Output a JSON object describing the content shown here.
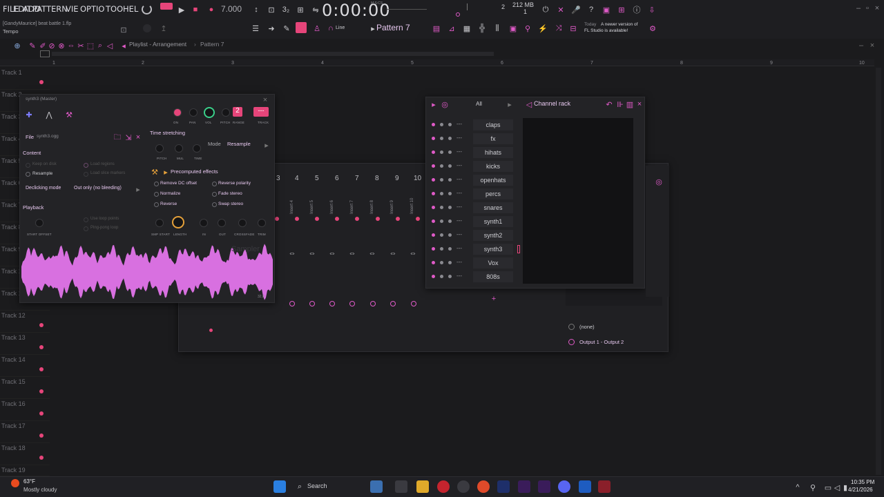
{
  "menu": [
    "FILE",
    "EDIT",
    "ADD",
    "PATTERN",
    "VIE",
    "OPTIO",
    "TOO",
    "HEL"
  ],
  "transport": {
    "tempo": "7.000",
    "clock": "0:00:00",
    "time_mode": "M:S:CS"
  },
  "perf": {
    "memory": "212 MB",
    "polyphony": "2",
    "cpu": "1"
  },
  "hint": {
    "project": "[GandyMaurice] beat battle 1.flp",
    "label": "Tempo"
  },
  "toolbar": {
    "snap": "Line",
    "pattern": "Pattern 7"
  },
  "news": {
    "day": "Today",
    "line1": "A newer version of",
    "line2": "FL Studio is available!"
  },
  "playlist": {
    "title": "Playlist - Arrangement",
    "pattern": "Pattern 7",
    "ruler": [
      "1",
      "2",
      "3",
      "4",
      "5",
      "6",
      "7",
      "8",
      "9",
      "10"
    ],
    "tracks": [
      "Track 1",
      "Track 2",
      "Track 3",
      "Track 4",
      "Track 5",
      "Track 6",
      "Track 7",
      "Track 8",
      "Track 9",
      "Track 10",
      "Track 11",
      "Track 12",
      "Track 13",
      "Track 14",
      "Track 15",
      "Track 16",
      "Track 17",
      "Track 18",
      "Track 19"
    ]
  },
  "sampler": {
    "title": "synth3 (Master)",
    "file_label": "File",
    "file_value": "synth3.ogg",
    "content": "Content",
    "keep_on_disk": "Keep on disk",
    "load_regions": "Load regions",
    "resample": "Resample",
    "load_slice": "Load slice markers",
    "declicking": "Declicking mode",
    "declick_value": "Out only (no bleeding)",
    "playback": "Playback",
    "use_loop": "Use loop points",
    "pingpong": "Ping-pong loop",
    "time_stretching": "Time stretching",
    "mode_label": "Mode",
    "mode_value": "Resample",
    "precomputed": "Precomputed effects",
    "remove_dc": "Remove DC offset",
    "normalize": "Normalize",
    "reverse": "Reverse",
    "reverse_polarity": "Reverse polarity",
    "fade_stereo": "Fade stereo",
    "swap_stereo": "Swap stereo",
    "top_knobs": [
      "ON",
      "PAN",
      "VOL",
      "PITCH",
      "RANGE",
      "TRACK"
    ],
    "range_value": "2",
    "track_value": "---",
    "stretch_knobs": [
      "PITCH",
      "MUL",
      "TIME"
    ],
    "fx_knobs": [
      "SMP START",
      "LENGTH",
      "IN",
      "OUT",
      "CROSSFADE",
      "TRIM"
    ],
    "start_offset": "START OFFSET",
    "watermark": "Sampler",
    "sample_label": "32,0"
  },
  "channel_rack": {
    "title": "Channel rack",
    "filter": "All",
    "channels": [
      "claps",
      "fx",
      "hihats",
      "kicks",
      "openhats",
      "percs",
      "snares",
      "synth1",
      "synth2",
      "synth3",
      "Vox",
      "808s"
    ]
  },
  "mixer": {
    "numbers": [
      "3",
      "4",
      "5",
      "6",
      "7",
      "8",
      "9",
      "10"
    ],
    "inserts": [
      "Insert 3",
      "Insert 4",
      "Insert 5",
      "Insert 6",
      "Insert 7",
      "Insert 8",
      "Insert 9",
      "Insert 10"
    ],
    "input": "(none)",
    "output": "Output 1 - Output 2"
  },
  "taskbar": {
    "temp": "63°F",
    "weather": "Mostly cloudy",
    "search": "Search",
    "time": "10:35 PM",
    "date": "4/21/2026"
  },
  "colors": {
    "accent": "#e05ac8",
    "record": "#e6457a",
    "bg": "#1b1b1d"
  }
}
